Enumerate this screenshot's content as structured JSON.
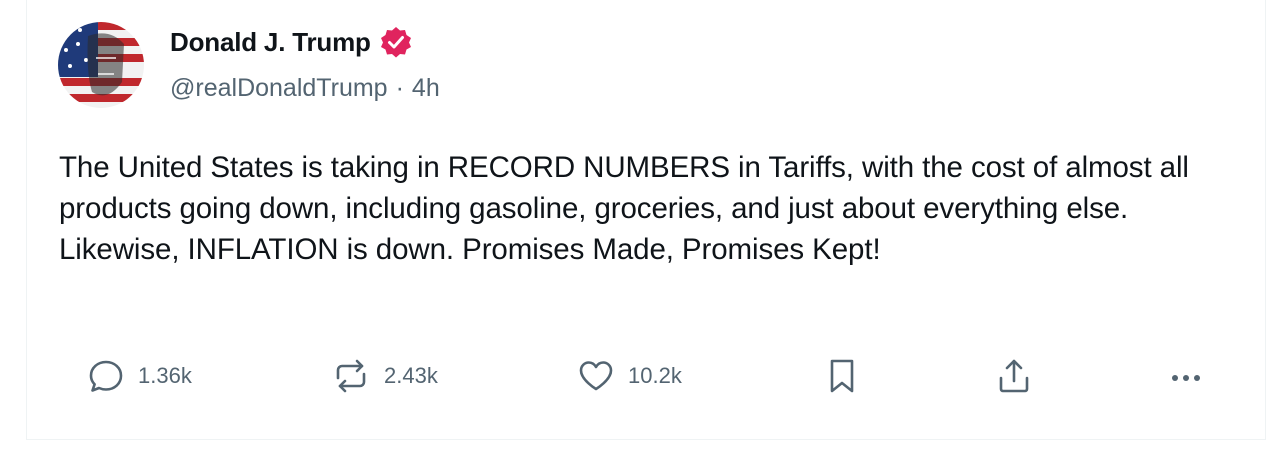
{
  "post": {
    "author": {
      "display_name": "Donald J. Trump",
      "verified": true,
      "handle": "@realDonaldTrump",
      "separator": "·",
      "time": "4h"
    },
    "text": "The United States is taking in RECORD NUMBERS in Tariffs, with the cost of almost all products going down, including gasoline, groceries, and just about everything else. Likewise, INFLATION is down. Promises Made, Promises Kept!",
    "actions": {
      "replies": "1.36k",
      "reposts": "2.43k",
      "likes": "10.2k"
    }
  },
  "icons": {
    "verified": "verified-badge-icon",
    "reply": "comment-bubble-icon",
    "repost": "repost-arrows-icon",
    "like": "heart-icon",
    "bookmark": "bookmark-icon",
    "share": "share-upload-icon",
    "more": "more-dots-icon"
  },
  "colors": {
    "verified_badge": "#e0245e",
    "text": "#0f1419",
    "muted": "#536471"
  }
}
